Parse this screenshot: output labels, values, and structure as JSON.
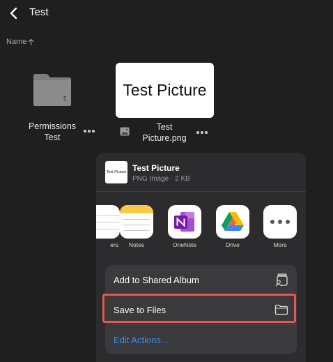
{
  "header": {
    "title": "Test",
    "back_icon": "chevron-left-icon"
  },
  "sort": {
    "label": "Name",
    "direction_icon": "arrow-up-icon"
  },
  "items": [
    {
      "name_line1": "Permissions",
      "name_line2": "Test",
      "type": "folder",
      "icon": "folder-icon"
    },
    {
      "name_line1": "Test",
      "name_line2": "Picture.png",
      "type": "image",
      "thumbnail_text": "Test Picture",
      "icon": "image-icon"
    }
  ],
  "share_sheet": {
    "file_title": "Test Picture",
    "file_subtitle": "PNG Image · 2 KB",
    "thumbnail_text": "Test Picture",
    "apps": [
      {
        "label": "ers",
        "icon": "reminders-icon"
      },
      {
        "label": "Notes",
        "icon": "notes-icon"
      },
      {
        "label": "OneNote",
        "icon": "onenote-icon"
      },
      {
        "label": "Drive",
        "icon": "google-drive-icon"
      },
      {
        "label": "More",
        "icon": "more-icon"
      }
    ],
    "actions": [
      {
        "label": "Add to Shared Album",
        "icon": "shared-album-icon"
      },
      {
        "label": "Save to Files",
        "icon": "folder-outline-icon"
      },
      {
        "label": "Edit Actions...",
        "icon": ""
      }
    ]
  },
  "colors": {
    "background": "#1f1f1f",
    "sheet": "#2c2c2e",
    "action_group": "#3a3a3c",
    "link": "#3b8cf5",
    "highlight": "#e8584f"
  }
}
